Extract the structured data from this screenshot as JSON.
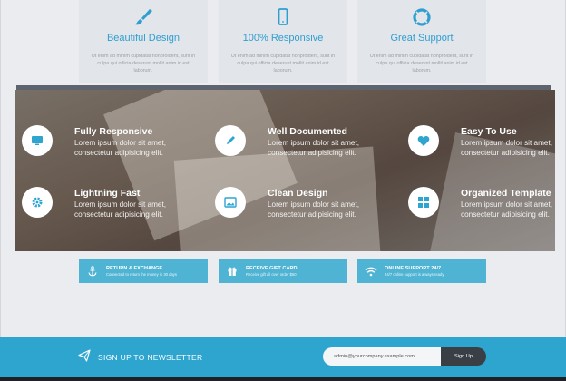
{
  "top_columns": [
    {
      "title": "Beautiful Design",
      "icon": "paintbrush-icon",
      "desc": "Ut enim ad minim cupidatat nonproident, sunt in culpa qui officia deserunt mollit anim id est laborum."
    },
    {
      "title": "100% Responsive",
      "icon": "mobile-phone-icon",
      "desc": "Ut enim ad minim cupidatat nonproident, sunt in culpa qui officia deserunt mollit anim id est laborum."
    },
    {
      "title": "Great Support",
      "icon": "lifebuoy-icon",
      "desc": "Ut enim ad minim cupidatat nonproident, sunt in culpa qui officia deserunt mollit anim id est laborum."
    }
  ],
  "features": [
    {
      "title": "Fully Responsive",
      "icon": "monitor-icon",
      "line1": "Lorem ipsum dolor sit amet,",
      "line2": "consectetur adipisicing elit."
    },
    {
      "title": "Well Documented",
      "icon": "pencil-icon",
      "line1": "Lorem ipsum dolor sit amet,",
      "line2": "consectetur adipisicing elit."
    },
    {
      "title": "Easy To Use",
      "icon": "heart-icon",
      "line1": "Lorem ipsum dolor sit amet,",
      "line2": "consectetur adipisicing elit."
    },
    {
      "title": "Lightning Fast",
      "icon": "gear-icon",
      "line1": "Lorem ipsum dolor sit amet,",
      "line2": "consectetur adipisicing elit."
    },
    {
      "title": "Clean Design",
      "icon": "image-icon",
      "line1": "Lorem ipsum dolor sit amet,",
      "line2": "consectetur adipisicing elit."
    },
    {
      "title": "Organized Template",
      "icon": "grid-icon",
      "line1": "Lorem ipsum dolor sit amet,",
      "line2": "consectetur adipisicing elit."
    }
  ],
  "info_pills": [
    {
      "title": "RETURN & EXCHANGE",
      "sub": "Connected to return the money in 30 days",
      "icon": "anchor-icon"
    },
    {
      "title": "RECEIVE GIFT CARD",
      "sub": "Receive gift all over order $50",
      "icon": "gift-icon"
    },
    {
      "title": "ONLINE SUPPORT 24/7",
      "sub": "24/7 online support is always ready",
      "icon": "wifi-icon"
    }
  ],
  "newsletter": {
    "label": "SIGN UP TO NEWSLETTER",
    "email_value": "admin@yourcompany.example.com",
    "button_label": "Sign Up"
  },
  "colors": {
    "accent": "#2da5cf",
    "pill": "#4fb3d3",
    "dark": "#3a3f46"
  }
}
